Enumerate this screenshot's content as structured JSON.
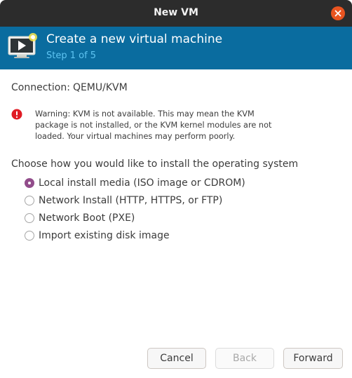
{
  "window": {
    "title": "New VM"
  },
  "header": {
    "title": "Create a new virtual machine",
    "step": "Step 1 of 5",
    "icon": "monitor-play-icon"
  },
  "connection": {
    "label": "Connection:",
    "value": "QEMU/KVM"
  },
  "warning": {
    "icon": "error-icon",
    "text": "Warning: KVM is not available. This may mean the KVM package is not installed, or the KVM kernel modules are not loaded. Your virtual machines may perform poorly."
  },
  "install": {
    "heading": "Choose how you would like to install the operating system",
    "options": [
      {
        "label": "Local install media (ISO image or CDROM)",
        "checked": true
      },
      {
        "label": "Network Install (HTTP, HTTPS, or FTP)",
        "checked": false
      },
      {
        "label": "Network Boot (PXE)",
        "checked": false
      },
      {
        "label": "Import existing disk image",
        "checked": false
      }
    ]
  },
  "buttons": {
    "cancel": "Cancel",
    "back": "Back",
    "forward": "Forward"
  },
  "colors": {
    "titlebar": "#2c2c2c",
    "banner": "#0a6c9f",
    "step_text": "#5ec4f2",
    "close_button": "#e95420",
    "radio_checked": "#924d8b",
    "warning_icon": "#e01b24"
  }
}
